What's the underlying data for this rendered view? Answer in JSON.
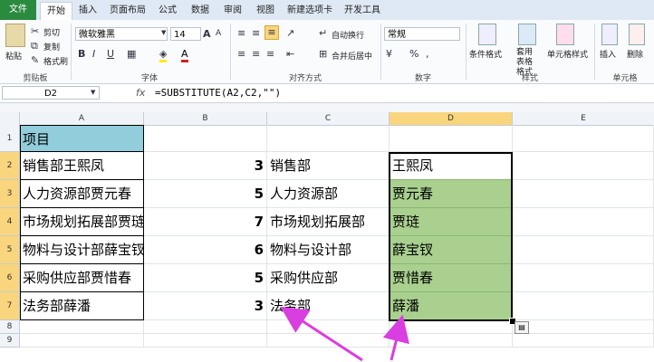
{
  "tabs": [
    "文件",
    "开始",
    "插入",
    "页面布局",
    "公式",
    "数据",
    "审阅",
    "视图",
    "新建选项卡",
    "开发工具"
  ],
  "ribbon": {
    "clipboard": {
      "paste": "粘贴",
      "cut": "剪切",
      "copy": "复制",
      "format_painter": "格式刷",
      "label": "剪贴板"
    },
    "font": {
      "name": "微软雅黑",
      "size": "14",
      "bold": "B",
      "italic": "I",
      "underline": "U",
      "label": "字体",
      "grow": "A",
      "shrink": "A"
    },
    "align": {
      "wrap": "自动换行",
      "merge": "合并后居中",
      "label": "对齐方式"
    },
    "number": {
      "format": "常规",
      "label": "数字",
      "percent": "%",
      "comma": ","
    },
    "styles": {
      "cond": "条件格式",
      "table": "套用表格格式",
      "cell": "单元格样式",
      "label": "样式"
    },
    "cells": {
      "insert": "插入",
      "delete": "删除",
      "label": "单元格"
    }
  },
  "formula_bar": {
    "name_box": "D2",
    "fx": "fx",
    "formula": "=SUBSTITUTE(A2,C2,\"\")"
  },
  "columns": [
    "A",
    "B",
    "C",
    "D",
    "E"
  ],
  "rows": [
    "1",
    "2",
    "3",
    "4",
    "5",
    "6",
    "7",
    "8",
    "9"
  ],
  "cells": {
    "a": [
      "项目",
      "销售部王熙凤",
      "人力资源部贾元春",
      "市场规划拓展部贾琏",
      "物料与设计部薛宝钗",
      "采购供应部贾惜春",
      "法务部薛潘"
    ],
    "b": [
      "",
      "3",
      "5",
      "7",
      "6",
      "5",
      "3"
    ],
    "c": [
      "",
      "销售部",
      "人力资源部",
      "市场规划拓展部",
      "物料与设计部",
      "采购供应部",
      "法务部"
    ],
    "d": [
      "",
      "王熙凤",
      "贾元春",
      "贾琏",
      "薛宝钗",
      "贾惜春",
      "薛潘"
    ]
  },
  "colors": {
    "header_fill": "#92cddc",
    "selection_fill": "#a9d08e",
    "arrow": "#d93ee0",
    "file_tab": "#2a8a3e"
  }
}
